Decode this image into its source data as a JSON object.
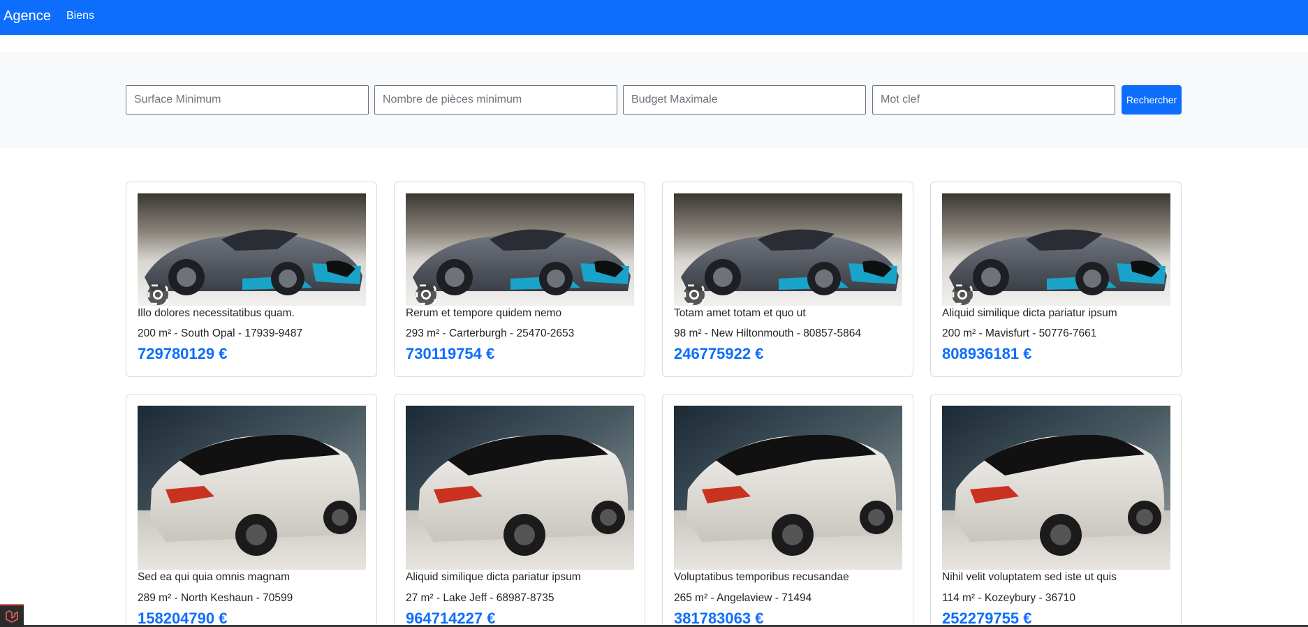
{
  "navbar": {
    "brand": "Agence",
    "link": "Biens",
    "color": "#0d6efd"
  },
  "search": {
    "surface_placeholder": "Surface Minimum",
    "rooms_placeholder": "Nombre de pièces minimum",
    "budget_placeholder": "Budget Maximale",
    "keyword_placeholder": "Mot clef",
    "button_label": "Rechercher"
  },
  "properties": [
    {
      "title": "Illo dolores necessitatibus quam.",
      "meta": "200 m² - South Opal - 17939-9487",
      "price": "729780129 €",
      "image": "sports-car-photo"
    },
    {
      "title": "Rerum et tempore quidem nemo",
      "meta": "293 m² - Carterburgh - 25470-2653",
      "price": "730119754 €",
      "image": "sports-car-photo"
    },
    {
      "title": "Totam amet totam et quo ut",
      "meta": "98 m² - New Hiltonmouth - 80857-5864",
      "price": "246775922 €",
      "image": "sports-car-photo"
    },
    {
      "title": "Aliquid similique dicta pariatur ipsum",
      "meta": "200 m² - Mavisfurt - 50776-7661",
      "price": "808936181 €",
      "image": "sports-car-photo"
    },
    {
      "title": "Sed ea qui quia omnis magnam",
      "meta": "289 m² - North Keshaun - 70599",
      "price": "158204790 €",
      "image": "white-suv-photo"
    },
    {
      "title": "Aliquid similique dicta pariatur ipsum",
      "meta": "27 m² - Lake Jeff - 68987-8735",
      "price": "964714227 €",
      "image": "white-suv-photo"
    },
    {
      "title": "Voluptatibus temporibus recusandae",
      "meta": "265 m² - Angelaview - 71494",
      "price": "381783063 €",
      "image": "white-suv-photo"
    },
    {
      "title": "Nihil velit voluptatem sed iste ut quis",
      "meta": "114 m² - Kozeybury - 36710",
      "price": "252279755 €",
      "image": "white-suv-photo"
    }
  ],
  "colors": {
    "accent": "#0d6efd",
    "search_band_bg": "#f8f9fa",
    "price": "#0d6efd"
  }
}
